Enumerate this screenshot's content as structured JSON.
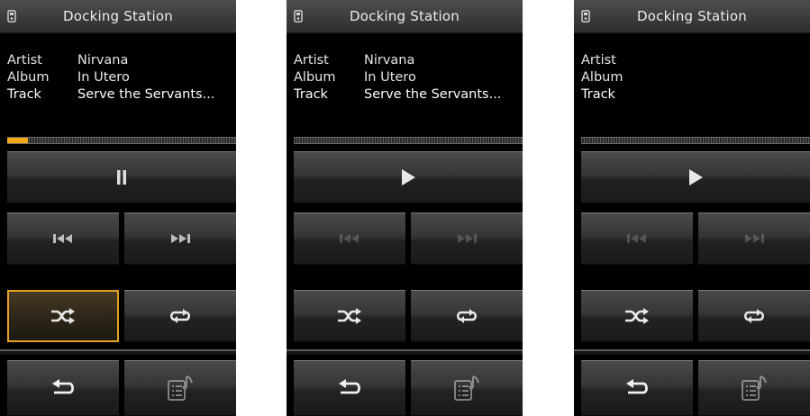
{
  "panels": [
    {
      "title": "Docking Station",
      "labels": {
        "artist": "Artist",
        "album": "Album",
        "track": "Track"
      },
      "artist": "Nirvana",
      "album": "In Utero",
      "track": "Serve the Servants...",
      "progress": 0.09,
      "play_state": "playing",
      "main_icon": "pause-icon",
      "skip_enabled": true,
      "shuffle_selected": true
    },
    {
      "title": "Docking Station",
      "labels": {
        "artist": "Artist",
        "album": "Album",
        "track": "Track"
      },
      "artist": "Nirvana",
      "album": "In Utero",
      "track": "Serve the Servants...",
      "progress": 0,
      "play_state": "paused",
      "main_icon": "play-icon",
      "skip_enabled": false,
      "shuffle_selected": false
    },
    {
      "title": "Docking Station",
      "labels": {
        "artist": "Artist",
        "album": "Album",
        "track": "Track"
      },
      "artist": "",
      "album": "",
      "track": "",
      "progress": 0,
      "play_state": "stopped",
      "main_icon": "play-icon",
      "skip_enabled": false,
      "shuffle_selected": false
    }
  ],
  "colors": {
    "accent": "#e5a120",
    "progress_fill": "#f0a818",
    "background": "#000000"
  },
  "icons": [
    "device-icon",
    "pause-icon",
    "play-icon",
    "previous-track-icon",
    "next-track-icon",
    "shuffle-icon",
    "repeat-icon",
    "back-icon",
    "playlist-icon"
  ]
}
